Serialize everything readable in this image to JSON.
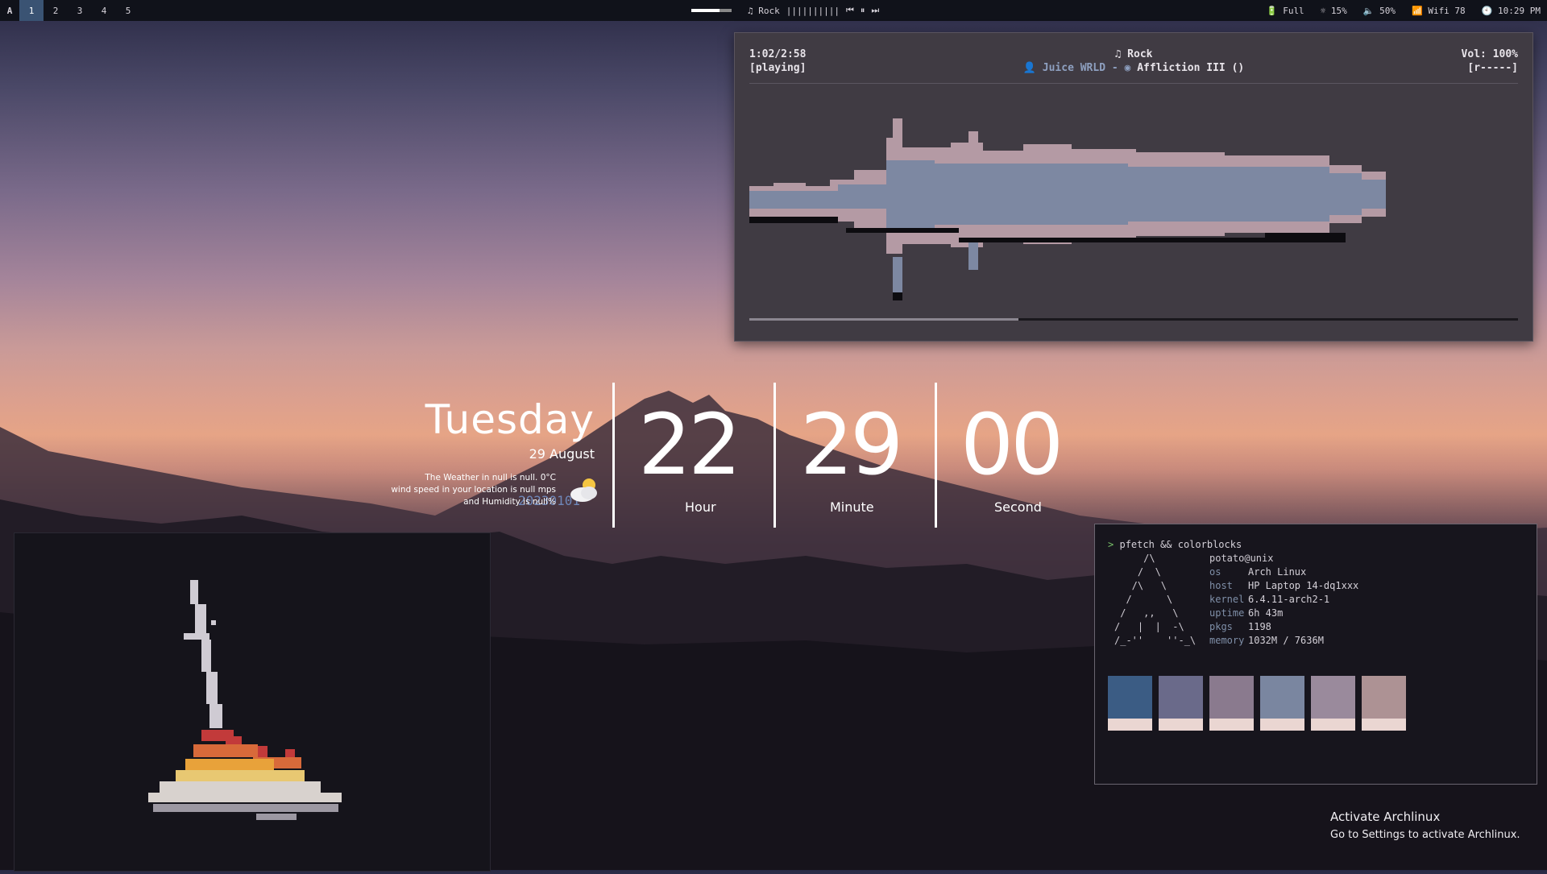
{
  "topbar": {
    "logo": "A",
    "workspaces": [
      "1",
      "2",
      "3",
      "4",
      "5"
    ],
    "active_workspace": "1",
    "music_label": "♫ Rock",
    "music_viz": "||||||||||",
    "prev_icon": "⏮",
    "pause_icon": "⏸",
    "next_icon": "⏭",
    "battery": "🔋 Full",
    "brightness": "☼ 15%",
    "volume": "🔈 50%",
    "wifi": "📶 Wifi 78",
    "clock": "🕙 10:29 PM"
  },
  "player": {
    "time": "1:02/2:58",
    "state": "[playing]",
    "genre": "♫ Rock",
    "artist": "Juice WRLD",
    "separator": "-",
    "album": "Affliction III",
    "album_date": "20230101",
    "volume": "Vol: 100%",
    "mode": "[r-----]",
    "progress": 0.35
  },
  "clock": {
    "day": "Tuesday",
    "date": "29 August",
    "weather_line1": "The Weather in null is null. 0°C",
    "weather_line2": "wind speed in your location is null mps",
    "weather_line3": "and Humidity is null%",
    "hour": "22",
    "minute": "29",
    "second": "00",
    "hour_label": "Hour",
    "minute_label": "Minute",
    "second_label": "Second"
  },
  "terminal": {
    "prompt_arrow": ">",
    "command": "pfetch && colorblocks",
    "user_host": "potato@unix",
    "ascii_art": "     /\\\n    /  \\\n   /\\   \\\n  /      \\\n /   ,,   \\\n/   |  |  -\\\n/_-''    ''-_\\",
    "rows": [
      {
        "key": "os",
        "value": "Arch Linux"
      },
      {
        "key": "host",
        "value": "HP Laptop 14-dq1xxx"
      },
      {
        "key": "kernel",
        "value": "6.4.11-arch2-1"
      },
      {
        "key": "uptime",
        "value": "6h 43m"
      },
      {
        "key": "pkgs",
        "value": "1198"
      },
      {
        "key": "memory",
        "value": "1032M / 7636M"
      }
    ],
    "colorblocks": [
      "#3b5c84",
      "#6a6a8a",
      "#8a7a8e",
      "#7a86a0",
      "#9a8a9c",
      "#ad9294"
    ],
    "colorblock_base": "#ead6d2"
  },
  "activation": {
    "title": "Activate Archlinux",
    "subtitle": "Go to Settings to activate Archlinux."
  }
}
